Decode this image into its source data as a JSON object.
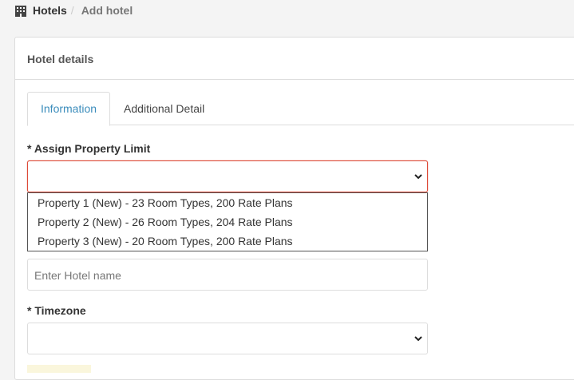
{
  "breadcrumb": {
    "icon": "building-icon",
    "home": "Hotels",
    "separator": "/",
    "current": "Add hotel"
  },
  "panel": {
    "heading": "Hotel details"
  },
  "tabs": [
    {
      "label": "Information",
      "active": true
    },
    {
      "label": "Additional Detail",
      "active": false
    }
  ],
  "form": {
    "property_limit": {
      "label": "* Assign Property Limit",
      "value": "",
      "options": [
        "Property 1 (New) - 23 Room Types, 200 Rate Plans",
        "Property 2 (New) - 26 Room Types, 204 Rate Plans",
        "Property 3 (New) - 20 Room Types, 200 Rate Plans"
      ]
    },
    "hotel_name": {
      "placeholder": "Enter Hotel name",
      "value": ""
    },
    "timezone": {
      "label": "* Timezone",
      "value": ""
    }
  },
  "colors": {
    "accent": "#3c8dbc",
    "error": "#dd4b39"
  }
}
